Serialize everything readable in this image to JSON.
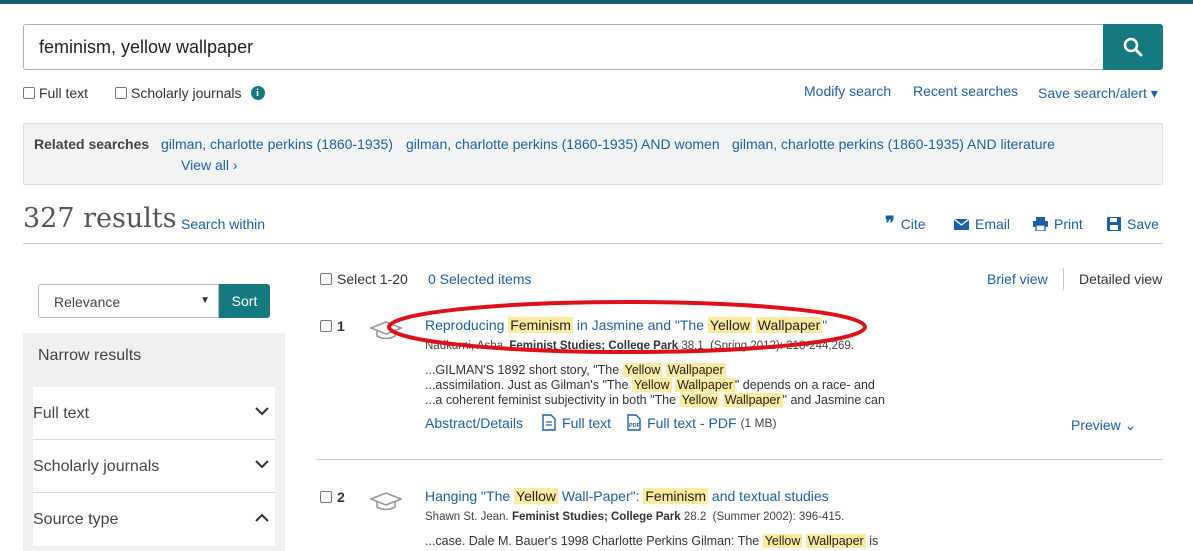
{
  "search": {
    "query": "feminism, yellow wallpaper"
  },
  "options": {
    "full_text": "Full text",
    "scholarly": "Scholarly journals"
  },
  "links": {
    "modify": "Modify search",
    "recent": "Recent searches",
    "save_alert": "Save search/alert ▾"
  },
  "related": {
    "label": "Related searches",
    "items": [
      "gilman, charlotte perkins (1860-1935)",
      "gilman, charlotte perkins (1860-1935) AND women",
      "gilman, charlotte perkins (1860-1935) AND literature"
    ],
    "view_all": "View all ›"
  },
  "results_header": {
    "count": "327 results",
    "search_within": "Search within",
    "tools": {
      "cite": "Cite",
      "email": "Email",
      "print": "Print",
      "save": "Save"
    }
  },
  "sort": {
    "selected": "Relevance",
    "button": "Sort"
  },
  "narrow": {
    "heading": "Narrow results",
    "facets": [
      {
        "label": "Full text",
        "state": "collapsed"
      },
      {
        "label": "Scholarly journals",
        "state": "collapsed"
      },
      {
        "label": "Source type",
        "state": "expanded"
      }
    ]
  },
  "selection": {
    "select_label": "Select 1-20",
    "selected_items": "0 Selected items"
  },
  "views": {
    "brief": "Brief view",
    "detailed": "Detailed view"
  },
  "results": [
    {
      "num": "1",
      "title_parts": [
        "Reproducing ",
        "Feminism",
        " in Jasmine and \"The ",
        "Yellow",
        " ",
        "Wallpaper",
        "\""
      ],
      "author": "Nadkarni, Asha.",
      "journal": "Feminist Studies; College Park",
      "volume": "38.1",
      "rest": "(Spring 2012): 218-244,269.",
      "snippets": [
        [
          "...GILMAN'S 1892 short story, \"The ",
          "Yellow",
          " ",
          "Wallpaper"
        ],
        [
          "...assimilation. Just as Gilman's \"The ",
          "Yellow",
          " ",
          "Wallpaper",
          "\" depends on a race- and"
        ],
        [
          "...a coherent feminist subjectivity in both \"The ",
          "Yellow",
          " ",
          "Wallpaper",
          "\" and Jasmine can"
        ]
      ],
      "abstract": "Abstract/Details",
      "full_text": "Full text",
      "pdf": "Full text - PDF",
      "pdf_size": "(1 MB)",
      "preview": "Preview ⌄"
    },
    {
      "num": "2",
      "title_parts": [
        "Hanging \"The ",
        "Yellow",
        " Wall-Paper\": ",
        "Feminism",
        " and textual studies"
      ],
      "author": "Shawn St. Jean.",
      "journal": "Feminist Studies; College Park",
      "volume": "28.2",
      "rest": "(Summer 2002): 396-415.",
      "snippets": [
        [
          "...case. Dale M. Bauer's 1998 Charlotte Perkins Gilman: The ",
          "Yellow",
          " ",
          "Wallpaper",
          " is"
        ]
      ]
    }
  ],
  "colors": {
    "accent": "#147a80",
    "link": "#1f5fa6",
    "highlight": "#fbeb9e",
    "annotation": "#e0101a"
  }
}
